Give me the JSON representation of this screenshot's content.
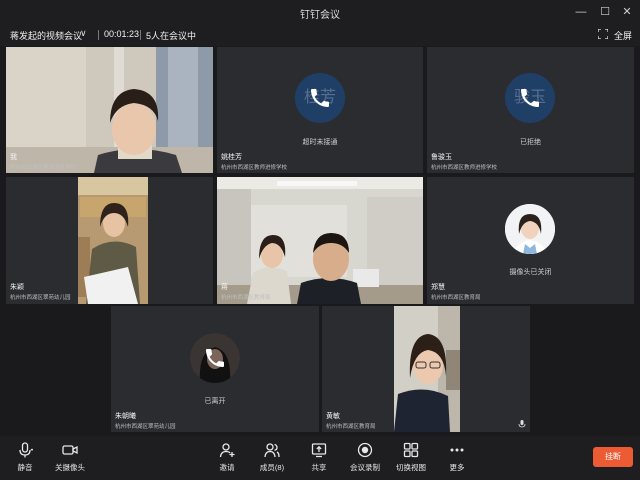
{
  "window": {
    "title": "钉钉会议",
    "minimize": "—",
    "maximize": "☐",
    "close": "✕"
  },
  "meeting": {
    "name": "蒋发起的视频会议",
    "chevron": "∨",
    "elapsed": "00:01:23",
    "people": "5人在会议中",
    "fullscreen_label": "全屏"
  },
  "participants": [
    {
      "name": "我",
      "org": "杭州市西湖区教师进修学校",
      "state": "video"
    },
    {
      "name": "姚桂芳",
      "org": "杭州市西湖区教师进修学校",
      "avatar_text": "桂芳",
      "status": "超时未接通"
    },
    {
      "name": "鲁骏玉",
      "org": "杭州市西湖区教师进修学校",
      "avatar_text": "骏玉",
      "status": "已拒绝"
    },
    {
      "name": "朱颖",
      "org": "杭州市西湖区翠苑幼儿园",
      "state": "video"
    },
    {
      "name": "蒋",
      "org": "杭州市西湖区教育局",
      "state": "video"
    },
    {
      "name": "郑慧",
      "org": "杭州市西湖区教育局",
      "status": "摄像头已关闭"
    },
    {
      "name": "朱朝曦",
      "org": "杭州市西湖区翠苑幼儿园",
      "status": "已离开"
    },
    {
      "name": "黄敏",
      "org": "杭州市西湖区教育局",
      "state": "video"
    }
  ],
  "toolbar": {
    "mute": "静音",
    "camera_off": "关摄像头",
    "invite": "邀请",
    "members": "成员(8)",
    "share": "共享",
    "record": "会议录制",
    "switch_view": "切换视图",
    "more": "更多",
    "hangup": "挂断"
  },
  "colors": {
    "background": "#1a1a1c",
    "tile": "#2b2c30",
    "avatar": "#1f3f66",
    "hangup": "#ec5b34"
  }
}
